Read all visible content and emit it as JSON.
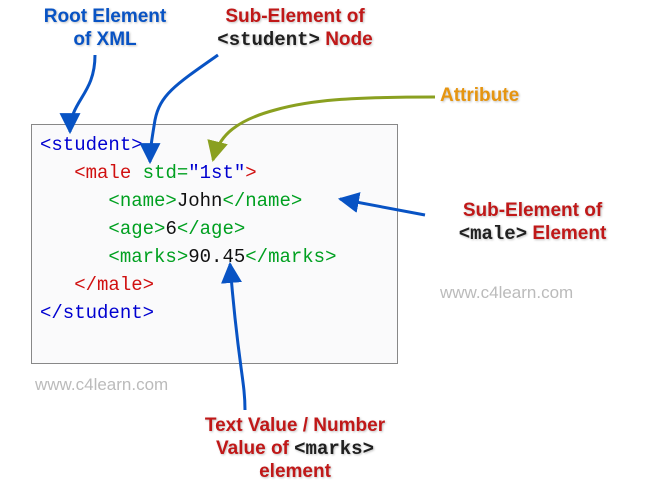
{
  "labels": {
    "root": "Root Element\nof XML",
    "sub_student_pre": "Sub-Element of\n",
    "sub_student_tag": "<student>",
    "sub_student_post": " Node",
    "attribute": "Attribute",
    "sub_male_pre": "Sub-Element of\n",
    "sub_male_tag": "<male>",
    "sub_male_post": " Element",
    "text_value_pre": "Text Value / Number\nValue of ",
    "text_value_tag": "<marks>",
    "text_value_post": "\nelement"
  },
  "code": {
    "l1_open": "<student>",
    "l2_open": "<male",
    "l2_attr_name": " std=",
    "l2_attr_val": "\"1st\"",
    "l2_close": ">",
    "l3_open": "<name>",
    "l3_text": "John",
    "l3_close": "</name>",
    "l4_open": "<age>",
    "l4_text": "6",
    "l4_close": "</age>",
    "l5_open": "<marks>",
    "l5_text": "90.45",
    "l5_close": "</marks>",
    "l6_close": "</male>",
    "l7_close": "</student>",
    "indent1": "   ",
    "indent2": "      "
  },
  "watermark": "www.c4learn.com",
  "chart_data": {
    "type": "diagram",
    "description": "Annotated XML snippet illustrating root element, sub-elements, attribute, and text value",
    "xml": {
      "root": "student",
      "children": [
        {
          "tag": "male",
          "attributes": {
            "std": "1st"
          },
          "children": [
            {
              "tag": "name",
              "text": "John"
            },
            {
              "tag": "age",
              "text": "6"
            },
            {
              "tag": "marks",
              "text": "90.45"
            }
          ]
        }
      ]
    },
    "annotations": [
      {
        "label": "Root Element of XML",
        "target": "<student>"
      },
      {
        "label": "Sub-Element of <student> Node",
        "target": "<male>"
      },
      {
        "label": "Attribute",
        "target": "std=\"1st\""
      },
      {
        "label": "Sub-Element of <male> Element",
        "target": "<name>"
      },
      {
        "label": "Text Value / Number Value of <marks> element",
        "target": "90.45"
      }
    ]
  }
}
